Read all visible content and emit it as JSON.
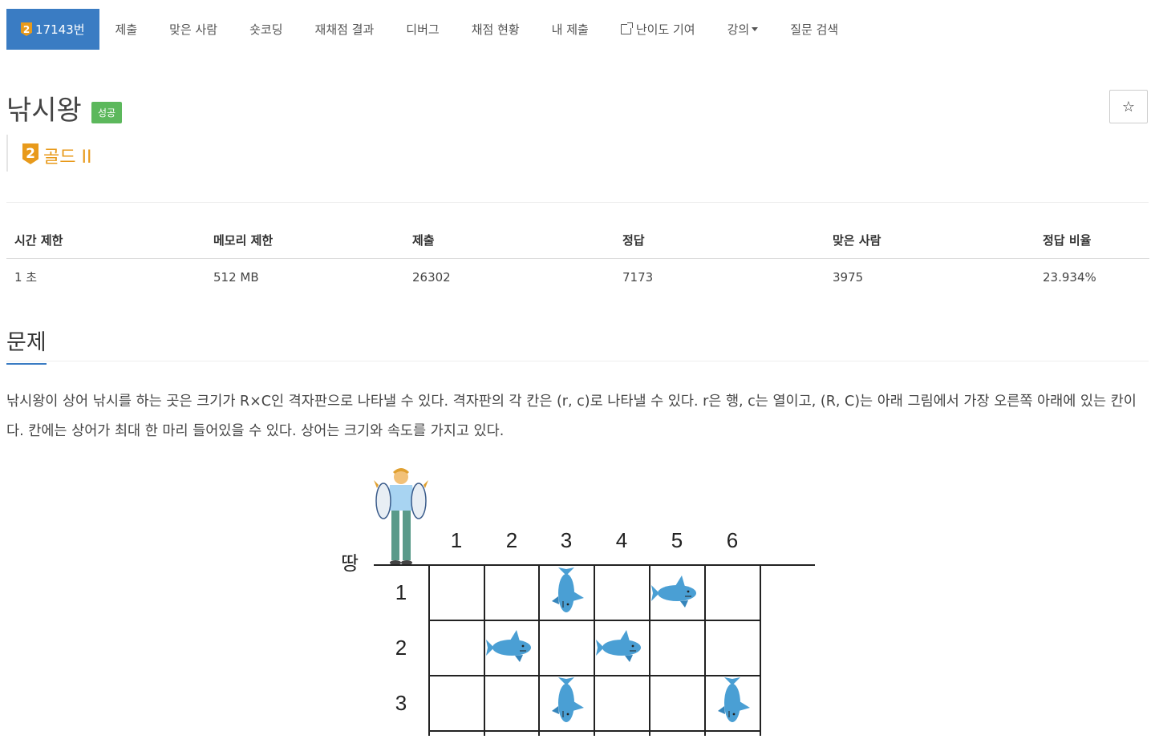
{
  "nav": {
    "problem_number": "17143번",
    "tier_digit": "2",
    "items": [
      "제출",
      "맞은 사람",
      "숏코딩",
      "재채점 결과",
      "디버그",
      "채점 현황",
      "내 제출",
      "난이도 기여",
      "강의",
      "질문 검색"
    ]
  },
  "title": "낚시왕",
  "status_label": "성공",
  "star_icon": "☆",
  "tier": {
    "digit": "2",
    "text": "골드 II"
  },
  "info_table": {
    "headers": [
      "시간 제한",
      "메모리 제한",
      "제출",
      "정답",
      "맞은 사람",
      "정답 비율"
    ],
    "values": [
      "1 초",
      "512 MB",
      "26302",
      "7173",
      "3975",
      "23.934%"
    ]
  },
  "section_title": "문제",
  "description": "낚시왕이 상어 낚시를 하는 곳은 크기가 R×C인 격자판으로 나타낼 수 있다. 격자판의 각 칸은 (r, c)로 나타낼 수 있다. r은 행, c는 열이고, (R, C)는 아래 그림에서 가장 오른쪽 아래에 있는 칸이다. 칸에는 상어가 최대 한 마리 들어있을 수 있다. 상어는 크기와 속도를 가지고 있다.",
  "figure": {
    "ground_label": "땅",
    "col_labels": [
      "1",
      "2",
      "3",
      "4",
      "5",
      "6"
    ],
    "row_labels": [
      "1",
      "2",
      "3"
    ]
  },
  "colors": {
    "nav_active": "#3a7cc3",
    "tier_gold": "#e89a1b",
    "success": "#5cb85c",
    "shark": "#4a9fd4"
  }
}
